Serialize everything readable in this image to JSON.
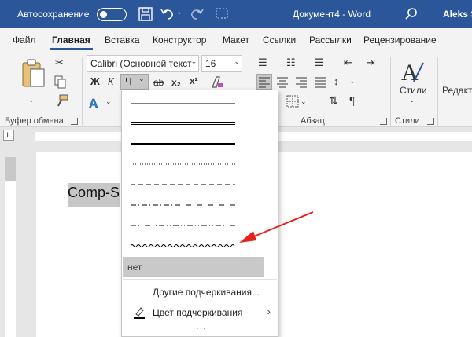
{
  "titlebar": {
    "autosave_label": "Автосохранение",
    "autosave_state": "off",
    "document_title": "Документ4  -  Word",
    "user_name": "Aleks S"
  },
  "tabs": [
    {
      "label": "Файл"
    },
    {
      "label": "Главная"
    },
    {
      "label": "Вставка"
    },
    {
      "label": "Конструктор"
    },
    {
      "label": "Макет"
    },
    {
      "label": "Ссылки"
    },
    {
      "label": "Рассылки"
    },
    {
      "label": "Рецензирование"
    }
  ],
  "ribbon": {
    "clipboard_label": "Буфер обмена",
    "font_name": "Calibri (Основной текст",
    "font_size": "16",
    "bold": "Ж",
    "italic": "К",
    "underline": "Ч",
    "strike": "ab",
    "subscript": "x₂",
    "superscript": "x²",
    "paragraph_label": "Абзац",
    "styles_btn": "Стили",
    "styles_label": "Стили",
    "editing_btn": "Редакт"
  },
  "document": {
    "text": "Comp-S"
  },
  "underline_menu": {
    "styles": [
      "single",
      "double",
      "thick",
      "dotted",
      "dashed",
      "dash-dot",
      "dash-dot-dot",
      "wave"
    ],
    "none_label": "нет",
    "more_label": "Другие подчеркивания...",
    "color_label": "Цвет подчеркивания",
    "color_accent": "#000000"
  },
  "annotation": {
    "arrow_color": "#e8201c"
  }
}
